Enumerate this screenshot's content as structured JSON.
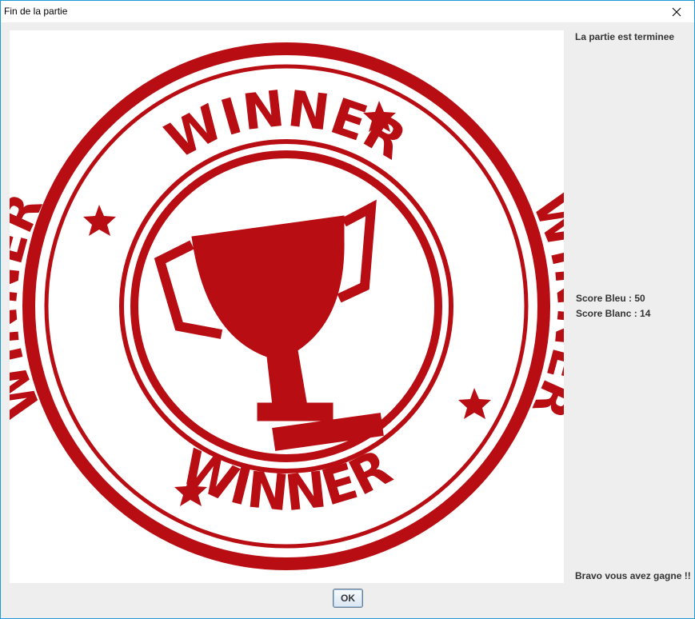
{
  "window": {
    "title": "Fin de la partie"
  },
  "image": {
    "ring_text": "WINNER",
    "stamp_color": "#b80d12"
  },
  "panel": {
    "status": "La partie est terminee",
    "score_blue": "Score Bleu : 50",
    "score_white": "Score Blanc : 14",
    "message": "Bravo vous avez gagne !!"
  },
  "buttons": {
    "ok": "OK"
  }
}
